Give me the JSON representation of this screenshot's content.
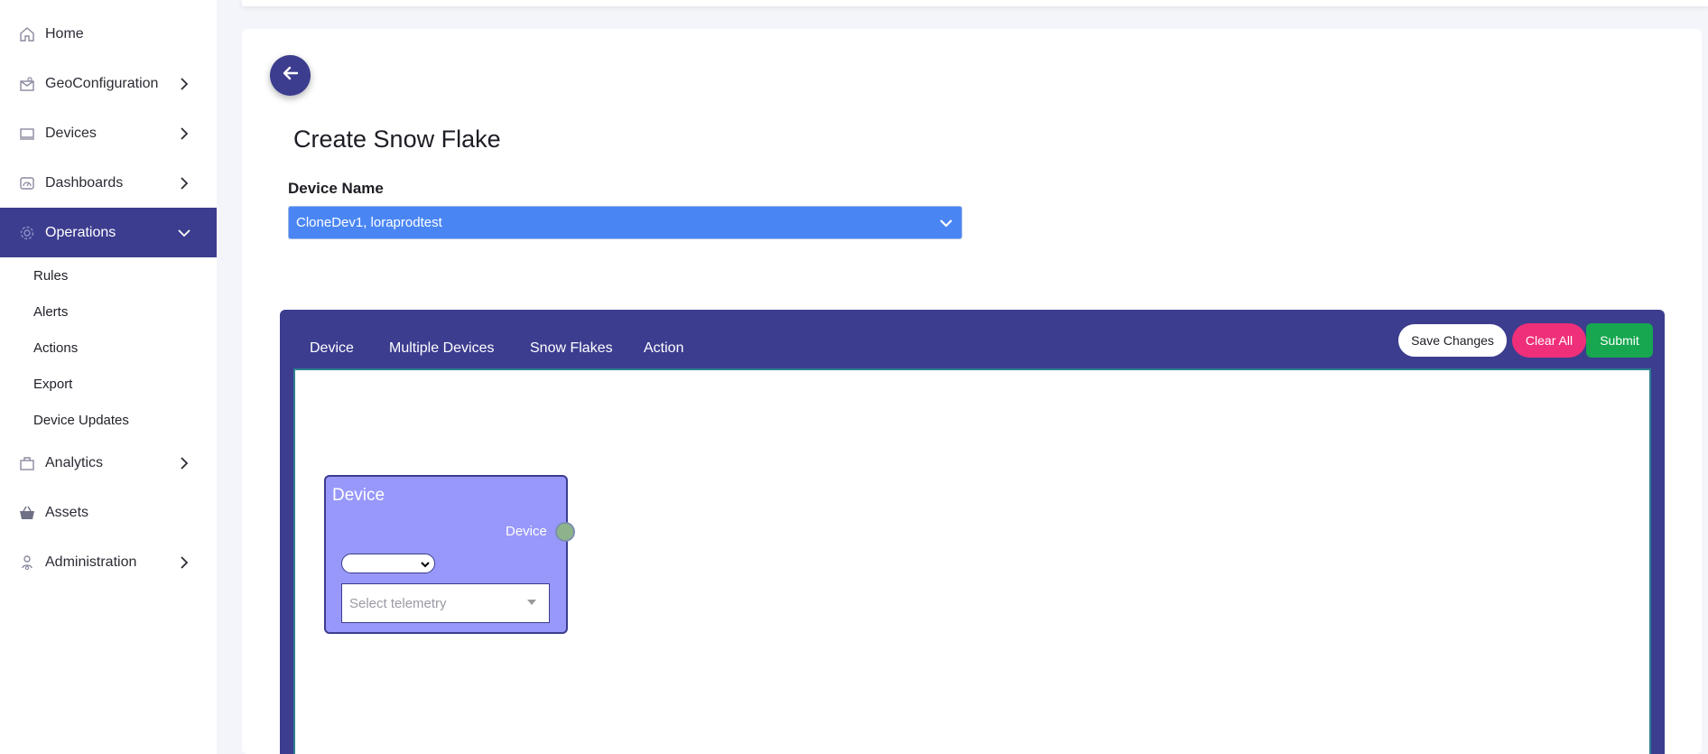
{
  "sidebar": {
    "items": [
      {
        "label": "Home",
        "icon": "home-icon"
      },
      {
        "label": "GeoConfiguration",
        "icon": "map-envelope-icon"
      },
      {
        "label": "Devices",
        "icon": "laptop-icon"
      },
      {
        "label": "Dashboards",
        "icon": "gauge-icon"
      },
      {
        "label": "Operations",
        "icon": "gear-icon"
      },
      {
        "label": "Analytics",
        "icon": "briefcase-icon"
      },
      {
        "label": "Assets",
        "icon": "basket-icon"
      },
      {
        "label": "Administration",
        "icon": "user-cog-icon"
      }
    ],
    "sub_items": [
      "Rules",
      "Alerts",
      "Actions",
      "Export",
      "Device Updates"
    ]
  },
  "page": {
    "title": "Create Snow Flake",
    "device_label": "Device Name",
    "device_value": "CloneDev1, loraprodtest"
  },
  "editor": {
    "tabs": [
      "Device",
      "Multiple Devices",
      "Snow Flakes",
      "Action"
    ],
    "buttons": {
      "save": "Save Changes",
      "clear": "Clear All",
      "submit": "Submit"
    }
  },
  "node": {
    "title": "Device",
    "port_label": "Device",
    "telemetry_placeholder": "Select telemetry"
  },
  "colors": {
    "primary": "#3c3d8f",
    "select_blue": "#4a86f3",
    "node_fill": "#9898fb",
    "clear": "#ef2f79",
    "submit": "#16a750",
    "port": "#8eb38a"
  }
}
